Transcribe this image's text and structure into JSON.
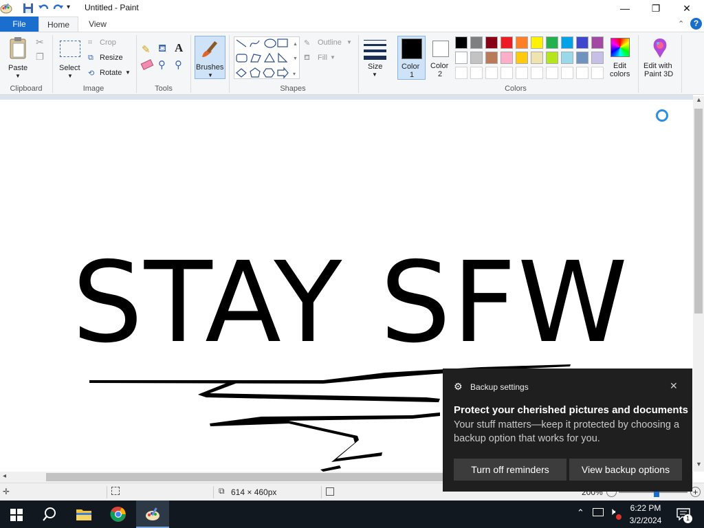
{
  "window": {
    "title": "Untitled - Paint",
    "controls": {
      "minimize": "—",
      "restore": "❐",
      "close": "✕"
    }
  },
  "tabs": {
    "file": "File",
    "home": "Home",
    "view": "View"
  },
  "ribbon": {
    "clipboard": {
      "label": "Clipboard",
      "paste": "Paste"
    },
    "image": {
      "label": "Image",
      "select": "Select",
      "crop": "Crop",
      "resize": "Resize",
      "rotate": "Rotate"
    },
    "tools": {
      "label": "Tools"
    },
    "brushes": {
      "label": "Brushes"
    },
    "shapes": {
      "label": "Shapes",
      "outline": "Outline",
      "fill": "Fill"
    },
    "size": {
      "label": "Size"
    },
    "color1": {
      "label1": "Color",
      "label2": "1"
    },
    "color2": {
      "label1": "Color",
      "label2": "2"
    },
    "colors": {
      "label": "Colors",
      "row1": [
        "#000000",
        "#7f7f7f",
        "#880015",
        "#ed1c24",
        "#ff7f27",
        "#fff200",
        "#22b14c",
        "#00a2e8",
        "#3f48cc",
        "#a349a4"
      ],
      "row2": [
        "#ffffff",
        "#c3c3c3",
        "#b97a57",
        "#ffaec9",
        "#ffc90e",
        "#efe4b0",
        "#b5e61d",
        "#99d9ea",
        "#7092be",
        "#c8bfe7"
      ]
    },
    "edit_colors": {
      "label1": "Edit",
      "label2": "colors"
    },
    "paint3d": {
      "label1": "Edit with",
      "label2": "Paint 3D"
    }
  },
  "canvas": {
    "text": "STAY SFW"
  },
  "statusbar": {
    "dimensions": "614 × 460px",
    "zoom": "200%"
  },
  "toast": {
    "header": "Backup settings",
    "title": "Protect your cherished pictures and documents",
    "body": "Your stuff matters—keep it protected by choosing a backup option that works for you.",
    "btn_off": "Turn off reminders",
    "btn_view": "View backup options"
  },
  "taskbar": {
    "time": "6:22 PM",
    "date": "3/2/2024",
    "notif_count": "1"
  }
}
